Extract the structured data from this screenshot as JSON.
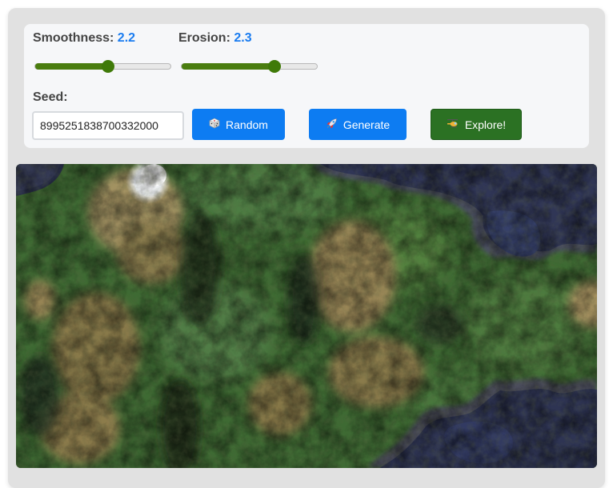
{
  "controls": {
    "smoothness": {
      "label": "Smoothness:",
      "value": "2.2",
      "fraction": 0.53
    },
    "erosion": {
      "label": "Erosion:",
      "value": "2.3",
      "fraction": 0.68
    },
    "seed": {
      "label": "Seed:",
      "value": "8995251838700332000"
    },
    "buttons": {
      "random": {
        "icon": "dice-icon",
        "label": "Random"
      },
      "generate": {
        "icon": "rocket-icon",
        "label": "Generate"
      },
      "explore": {
        "icon": "helicopter-icon",
        "label": "Explore!"
      }
    }
  },
  "colors": {
    "accent_blue": "#0d7cf2",
    "accent_green": "#2b7123",
    "slider_fill": "#4a7d0f",
    "value_text": "#1a7cf0"
  },
  "terrain": {
    "description_icon": "terrain-map-canvas"
  }
}
